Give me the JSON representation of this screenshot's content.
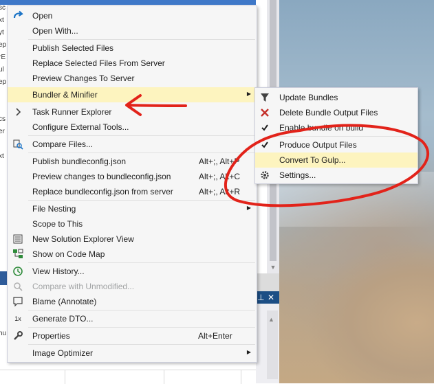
{
  "background": {
    "left_fragments": [
      "sc",
      "xt",
      "yt",
      "ep",
      "rE",
      "ul",
      "ep",
      "cs",
      "er",
      "xt",
      "re",
      "nu"
    ],
    "tool_header_icons": [
      "pin-icon",
      "close-icon"
    ]
  },
  "main_menu": {
    "items": [
      {
        "label": "Open",
        "icon": "open-arrow-icon"
      },
      {
        "label": "Open With..."
      },
      {
        "label": "Publish Selected Files"
      },
      {
        "label": "Replace Selected Files From Server"
      },
      {
        "label": "Preview Changes To Server"
      },
      {
        "label": "Bundler & Minifier",
        "submenu": true
      },
      {
        "label": "Task Runner Explorer",
        "icon": "chevron-right-icon"
      },
      {
        "label": "Configure External Tools..."
      },
      {
        "label": "Compare Files...",
        "icon": "compare-files-icon"
      },
      {
        "label": "Publish bundleconfig.json",
        "shortcut": "Alt+;, Alt+P"
      },
      {
        "label": "Preview changes to bundleconfig.json",
        "shortcut": "Alt+;, Alt+C"
      },
      {
        "label": "Replace bundleconfig.json from server",
        "shortcut": "Alt+;, Alt+R"
      },
      {
        "label": "File Nesting",
        "submenu": true
      },
      {
        "label": "Scope to This"
      },
      {
        "label": "New Solution Explorer View",
        "icon": "solution-explorer-icon"
      },
      {
        "label": "Show on Code Map",
        "icon": "code-map-icon"
      },
      {
        "label": "View History...",
        "icon": "history-icon"
      },
      {
        "label": "Compare with Unmodified...",
        "icon": "compare-icon",
        "disabled": true
      },
      {
        "label": "Blame (Annotate)",
        "icon": "comment-icon"
      },
      {
        "label": "Generate DTO...",
        "icon": "dto-icon",
        "icon_text": "1x"
      },
      {
        "label": "Properties",
        "shortcut": "Alt+Enter",
        "icon": "wrench-icon"
      },
      {
        "label": "Image Optimizer",
        "submenu": true
      }
    ]
  },
  "sub_menu": {
    "items": [
      {
        "label": "Update Bundles",
        "icon": "funnel-icon"
      },
      {
        "label": "Delete Bundle Output Files",
        "icon": "delete-x-icon"
      },
      {
        "label": "Enable bundle on build",
        "icon": "check-icon"
      },
      {
        "label": "Produce Output Files",
        "icon": "check-icon"
      },
      {
        "label": "Convert To Gulp...",
        "highlighted": true
      },
      {
        "label": "Settings...",
        "icon": "gear-icon"
      }
    ]
  },
  "colors": {
    "menu_bg": "#f6f6f6",
    "highlight": "#fdf4bf",
    "annotation_red": "#e2231a",
    "ide_blue": "#3f78c8"
  }
}
